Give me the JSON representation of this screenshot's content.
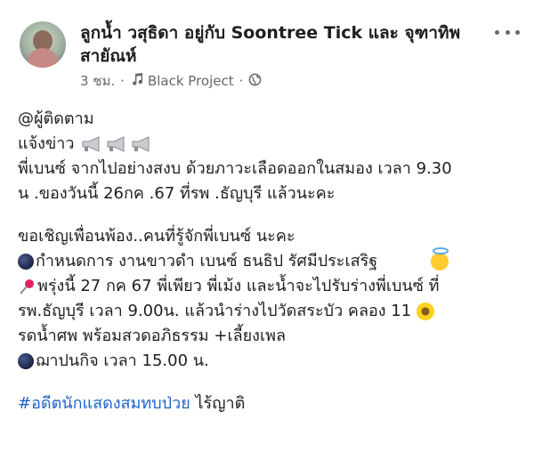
{
  "post": {
    "author_line": "ลูกน้ำ วสุธิดา อยู่กับ Soontree Tick และ จุฑาทิพ สายัณห์",
    "time": "3 ชม.",
    "separator": "·",
    "music_label": "Black Project",
    "icons": {
      "more": "more-dots-icon",
      "music": "music-note-icon",
      "privacy": "globe-icon"
    }
  },
  "content": {
    "line1": "@ผู้ติดตาม",
    "line2": "แจ้งข่าว",
    "line3": "พี่เบนซ์ จากไปอย่างสงบ ด้วยภาวะเลือดออกในสมอง เวลา 9.30",
    "line4": "น .ของวันนี้ 26กค .67  ที่รพ .ธัญบุรี แล้วนะคะ",
    "line5": "ขอเชิญเพื่อนพ้อง..คนที่รู้จักพี่เบนซ์ นะคะ",
    "line6": "กำหนดการ งานขาวดำ เบนซ์ ธนธิป  รัศมีประเสริฐ",
    "line7": "พรุ่งนี้ 27 กค 67 พี่เพียว พี่เม้ง และน้ำจะไปรับร่างพี่เบนซ์  ที่",
    "line8": "รพ.ธัญบุรี  เวลา 9.00น. แล้วนำร่างไปวัดสระบัว คลอง 11",
    "line9": "รดน้ำศพ พร้อมสวดอภิธรรม +เลี้ยงเพล",
    "line10": "ฌาปนกิจ เวลา 15.00 น.",
    "hashtag": "#อดีตนักแสดงสมทบป่วย",
    "hashtag_suffix": " ไร้ญาติ"
  }
}
